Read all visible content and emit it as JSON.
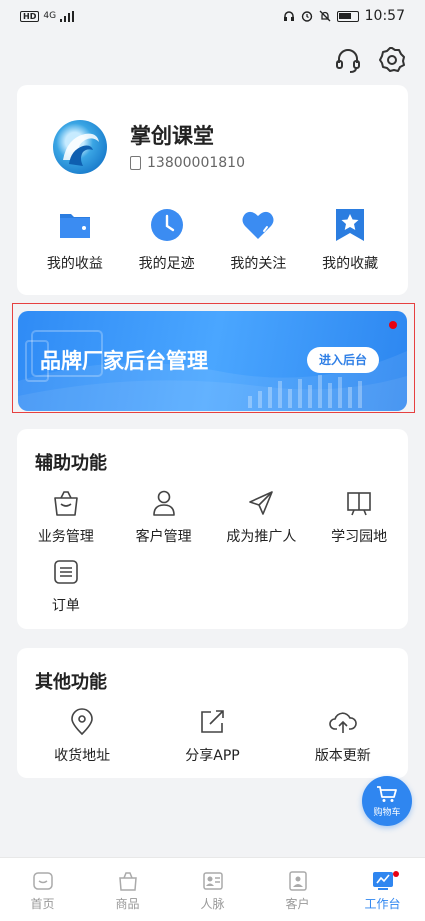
{
  "status_bar": {
    "hd": "HD",
    "network": "4G",
    "time": "10:57"
  },
  "header_icons": [
    "headset-icon",
    "settings-icon"
  ],
  "profile": {
    "name": "掌创课堂",
    "phone": "13800001810",
    "quick_links": [
      {
        "label": "我的收益",
        "icon": "wallet-icon"
      },
      {
        "label": "我的足迹",
        "icon": "clock-icon"
      },
      {
        "label": "我的关注",
        "icon": "heart-icon"
      },
      {
        "label": "我的收藏",
        "icon": "star-bookmark-icon"
      }
    ]
  },
  "banner": {
    "title": "品牌厂家后台管理",
    "button": "进入后台"
  },
  "assist": {
    "title": "辅助功能",
    "items": [
      {
        "label": "业务管理",
        "icon": "shopping-bag-icon"
      },
      {
        "label": "客户管理",
        "icon": "user-icon"
      },
      {
        "label": "成为推广人",
        "icon": "send-icon"
      },
      {
        "label": "学习园地",
        "icon": "notice-board-icon"
      },
      {
        "label": "订单",
        "icon": "order-list-icon"
      }
    ]
  },
  "other": {
    "title": "其他功能",
    "items": [
      {
        "label": "收货地址",
        "icon": "location-pin-icon"
      },
      {
        "label": "分享APP",
        "icon": "share-icon"
      },
      {
        "label": "版本更新",
        "icon": "cloud-upload-icon"
      }
    ]
  },
  "cart": {
    "label": "购物车"
  },
  "tabs": [
    {
      "label": "首页",
      "icon": "home-icon",
      "active": false
    },
    {
      "label": "商品",
      "icon": "bag-icon",
      "active": false
    },
    {
      "label": "人脉",
      "icon": "contact-card-icon",
      "active": false
    },
    {
      "label": "客户",
      "icon": "customer-icon",
      "active": false
    },
    {
      "label": "工作台",
      "icon": "workbench-icon",
      "active": true
    }
  ],
  "colors": {
    "accent": "#2f86f0",
    "badge": "#e60012",
    "highlight_border": "#e64040"
  }
}
